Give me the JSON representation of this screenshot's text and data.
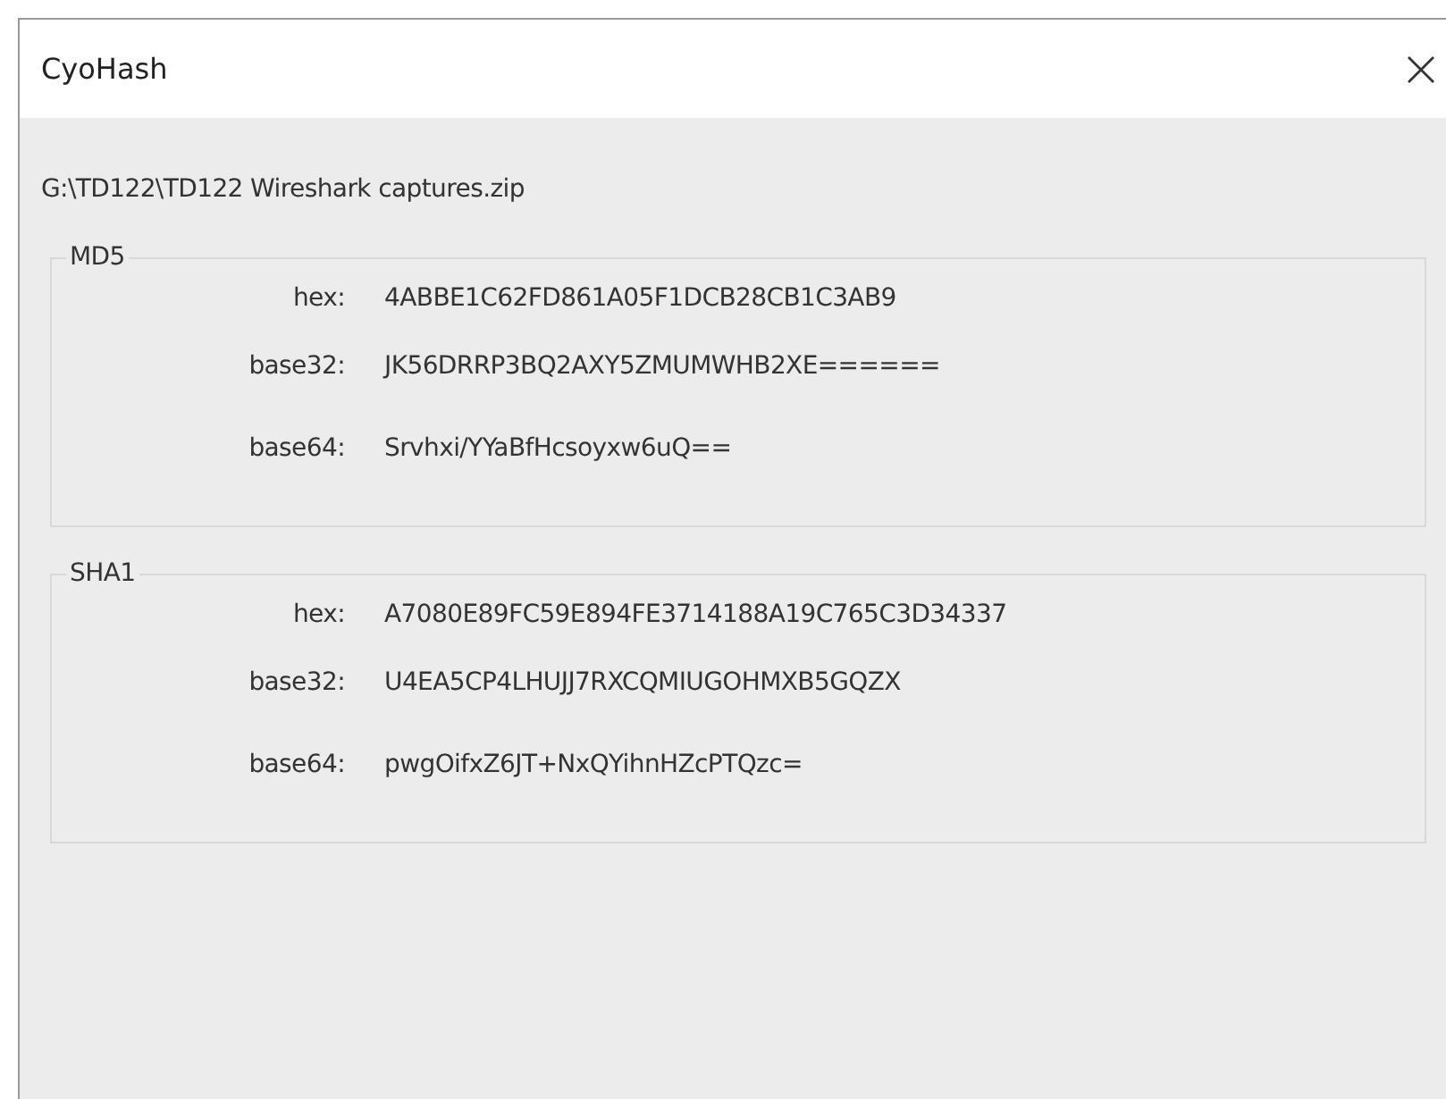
{
  "window": {
    "title": "CyoHash"
  },
  "file_path": "G:\\TD122\\TD122 Wireshark captures.zip",
  "groups": [
    {
      "title": "MD5",
      "rows": [
        {
          "label": "hex:",
          "value": "4ABBE1C62FD861A05F1DCB28CB1C3AB9"
        },
        {
          "label": "base32:",
          "value": "JK56DRRP3BQ2AXY5ZMUMWHB2XE======"
        },
        {
          "label": "base64:",
          "value": "Srvhxi/YYaBfHcsoyxw6uQ=="
        }
      ]
    },
    {
      "title": "SHA1",
      "rows": [
        {
          "label": "hex:",
          "value": "A7080E89FC59E894FE3714188A19C765C3D34337"
        },
        {
          "label": "base32:",
          "value": "U4EA5CP4LHUJJ7RXCQMIUGOHMXB5GQZX"
        },
        {
          "label": "base64:",
          "value": "pwgOifxZ6JT+NxQYihnHZcPTQzc="
        }
      ]
    }
  ]
}
